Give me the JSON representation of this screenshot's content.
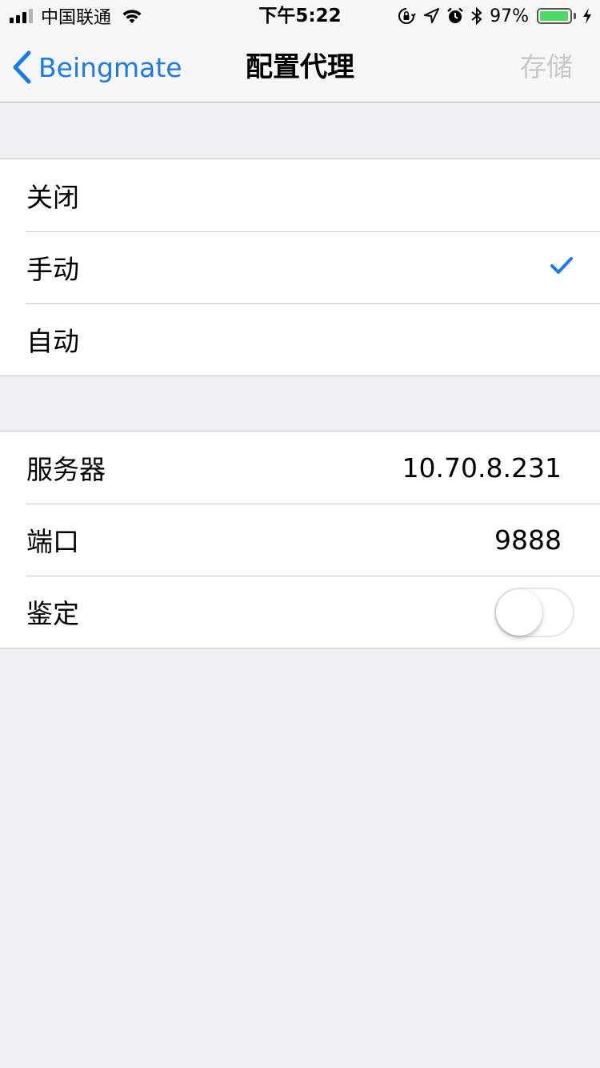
{
  "status_bar": {
    "carrier": "中国联通",
    "time": "下午5:22",
    "battery_percent": "97%",
    "battery_level": 0.97,
    "signal_bars": 4,
    "signal_active": 3,
    "icons": [
      "signal-icon",
      "wifi-icon",
      "orientation-lock-icon",
      "location-icon",
      "alarm-icon",
      "bluetooth-icon",
      "battery-icon",
      "charging-icon"
    ]
  },
  "nav": {
    "back_label": "Beingmate",
    "title": "配置代理",
    "save_label": "存储"
  },
  "proxy_mode": {
    "options": [
      {
        "label": "关闭",
        "selected": false
      },
      {
        "label": "手动",
        "selected": true
      },
      {
        "label": "自动",
        "selected": false
      }
    ]
  },
  "manual_settings": {
    "server_label": "服务器",
    "server_value": "10.70.8.231",
    "port_label": "端口",
    "port_value": "9888",
    "auth_label": "鉴定",
    "auth_enabled": false
  },
  "colors": {
    "accent": "#1a7bf0",
    "background": "#efeff4",
    "battery": "#4cd964",
    "disabled": "#c7c7cc"
  }
}
